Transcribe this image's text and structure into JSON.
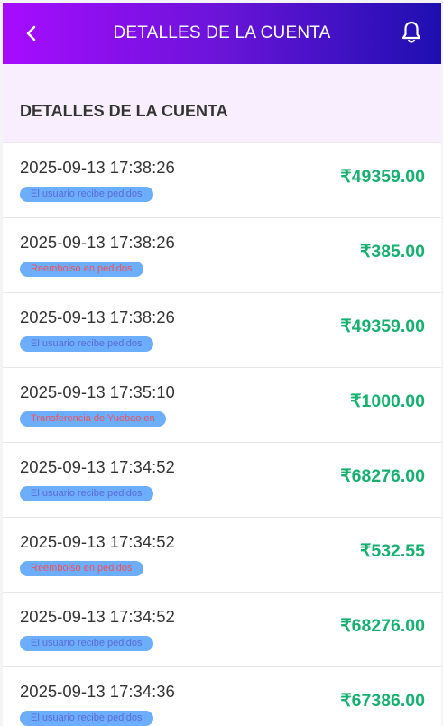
{
  "header": {
    "title": "DETALLES DE LA CUENTA"
  },
  "section": {
    "title": "DETALLES DE LA CUENTA"
  },
  "colors": {
    "header_gradient": [
      "#a70cff",
      "#6a14d8",
      "#1d0fb0"
    ],
    "amount": "#18b071",
    "badge_bg": "#6cadfc",
    "badge_text_blue": "#5a6cd6",
    "badge_text_red": "#f0535b"
  },
  "transactions": [
    {
      "date": "2025-09-13 17:38:26",
      "type": "El usuario recibe pedidos",
      "amount": "₹49359.00",
      "badge_color": "blue"
    },
    {
      "date": "2025-09-13 17:38:26",
      "type": "Reembolso en pedidos",
      "amount": "₹385.00",
      "badge_color": "red"
    },
    {
      "date": "2025-09-13 17:38:26",
      "type": "El usuario recibe pedidos",
      "amount": "₹49359.00",
      "badge_color": "blue"
    },
    {
      "date": "2025-09-13 17:35:10",
      "type": "Transferencia de Yuebao en",
      "amount": "₹1000.00",
      "badge_color": "red"
    },
    {
      "date": "2025-09-13 17:34:52",
      "type": "El usuario recibe pedidos",
      "amount": "₹68276.00",
      "badge_color": "blue"
    },
    {
      "date": "2025-09-13 17:34:52",
      "type": "Reembolso en pedidos",
      "amount": "₹532.55",
      "badge_color": "red"
    },
    {
      "date": "2025-09-13 17:34:52",
      "type": "El usuario recibe pedidos",
      "amount": "₹68276.00",
      "badge_color": "blue"
    },
    {
      "date": "2025-09-13 17:34:36",
      "type": "El usuario recibe pedidos",
      "amount": "₹67386.00",
      "badge_color": "blue"
    }
  ]
}
